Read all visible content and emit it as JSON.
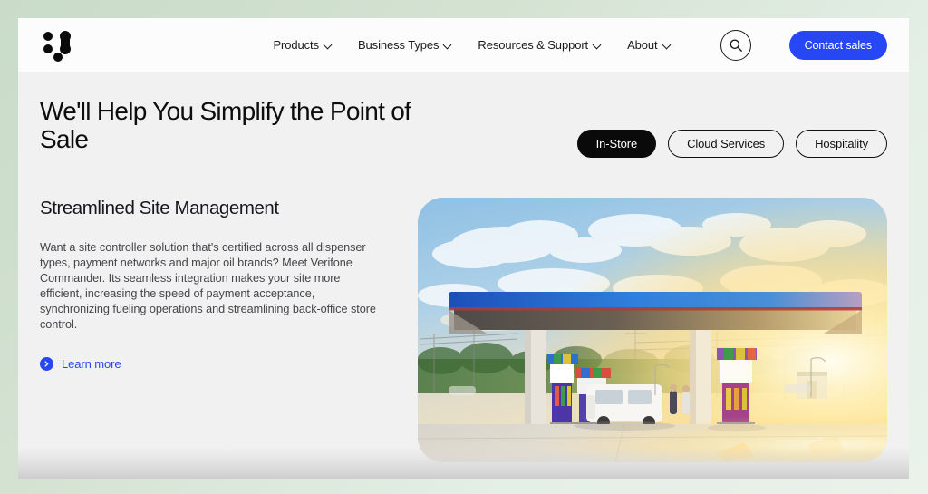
{
  "header": {
    "logo_name": "verifone-logo",
    "nav": [
      {
        "label": "Products",
        "icon": "chevron-down-icon"
      },
      {
        "label": "Business Types",
        "icon": "chevron-down-icon"
      },
      {
        "label": "Resources & Support",
        "icon": "chevron-down-icon"
      },
      {
        "label": "About",
        "icon": "chevron-down-icon"
      }
    ],
    "search_icon": "search-icon",
    "contact_sales_label": "Contact sales"
  },
  "hero": {
    "title": "We'll Help You Simplify the Point of Sale",
    "tabs": [
      {
        "label": "In-Store",
        "active": true
      },
      {
        "label": "Cloud Services",
        "active": false
      },
      {
        "label": "Hospitality",
        "active": false
      }
    ]
  },
  "content": {
    "section_title": "Streamlined Site Management",
    "body": "Want a site controller solution that's certified across all dispenser types, payment networks and major oil brands? Meet Verifone Commander. Its seamless integration makes your site more efficient, increasing the speed of payment acceptance, synchronizing fueling operations and streamlining back-office store control.",
    "learn_more_label": "Learn more",
    "learn_more_icon": "arrow-right-circle-icon",
    "image_alt": "Gas station forecourt with fuel dispensers under a blue canopy at sunset"
  },
  "colors": {
    "accent_blue": "#2747f5",
    "active_tab_bg": "#0a0a0a",
    "page_bg": "#f1f1f1",
    "header_bg": "#fcfcfc",
    "outer_bg": "#d4e2d2",
    "body_text": "#45464b"
  }
}
